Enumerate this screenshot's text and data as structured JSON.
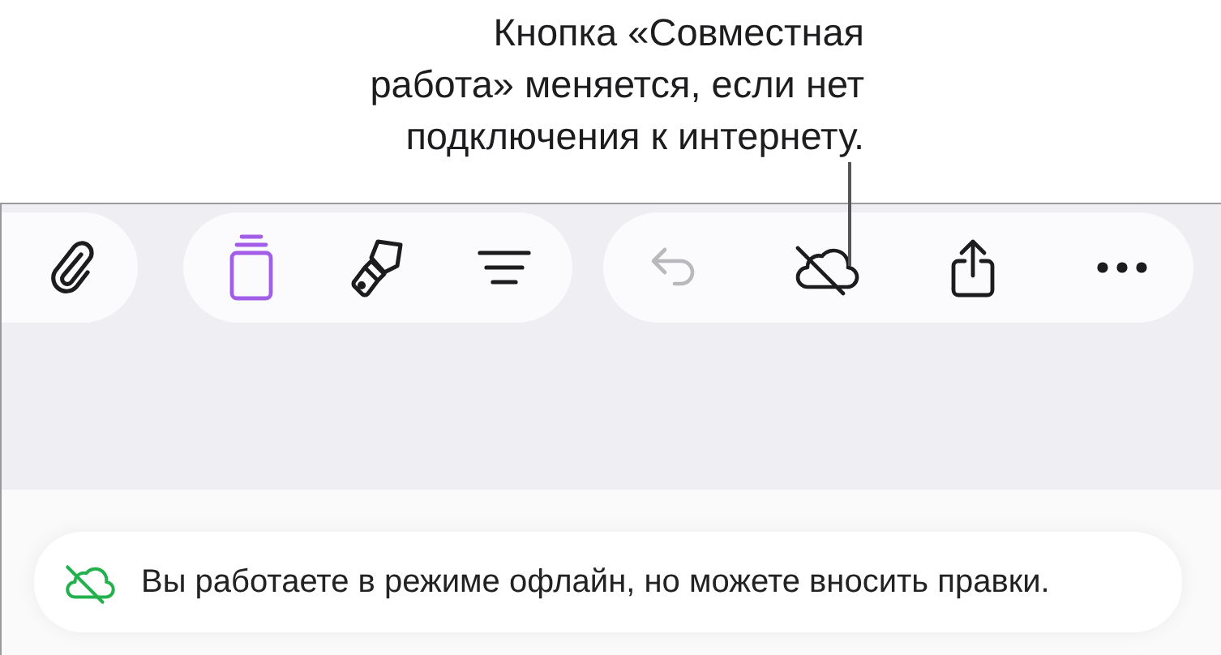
{
  "callout": {
    "lines": [
      "Кнопка «Совместная",
      "работа» меняется, если нет",
      "подключения к интернету."
    ]
  },
  "toolbar": {
    "groups": [
      {
        "buttons": [
          {
            "kind": "paperclip",
            "selected": false,
            "disabled": false
          }
        ]
      },
      {
        "buttons": [
          {
            "kind": "stack",
            "selected": true,
            "disabled": false
          },
          {
            "kind": "brush",
            "selected": false,
            "disabled": false
          },
          {
            "kind": "format",
            "selected": false,
            "disabled": false
          }
        ]
      },
      {
        "buttons": [
          {
            "kind": "undo",
            "selected": false,
            "disabled": true
          },
          {
            "kind": "cloud-off",
            "selected": false,
            "disabled": false
          },
          {
            "kind": "share",
            "selected": false,
            "disabled": false
          },
          {
            "kind": "more",
            "selected": false,
            "disabled": false
          }
        ]
      }
    ]
  },
  "banner": {
    "text": "Вы работаете в режиме офлайн, но можете вносить правки."
  }
}
